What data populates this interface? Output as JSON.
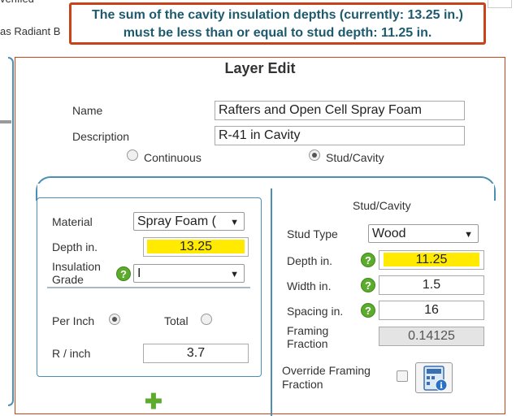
{
  "background": {
    "partial_label_top": "verified",
    "partial_label_radiant": "as Radiant B"
  },
  "error": {
    "line1": "The sum of the cavity insulation depths (currently: 13.25 in.)",
    "line2": "must be less than or equal to stud depth: 11.25 in."
  },
  "layer_edit": {
    "title": "Layer Edit",
    "name_label": "Name",
    "name_value": "Rafters and Open Cell Spray Foam",
    "description_label": "Description",
    "description_value": "R-41 in Cavity",
    "continuous_label": "Continuous",
    "stud_cavity_label": "Stud/Cavity",
    "selected_type": "Stud/Cavity"
  },
  "material_panel": {
    "material_label": "Material",
    "material_value": "Spray Foam (",
    "depth_label": "Depth in.",
    "depth_value": "13.25",
    "insulation_grade_label": "Insulation Grade",
    "insulation_grade_value": "I",
    "per_inch_label": "Per Inch",
    "total_label": "Total",
    "selected_mode": "Per Inch",
    "r_label": "R / inch",
    "r_value": "3.7",
    "add_icon": "plus-icon"
  },
  "stud_panel": {
    "title": "Stud/Cavity",
    "stud_type_label": "Stud Type",
    "stud_type_value": "Wood",
    "depth_label": "Depth in.",
    "depth_value": "11.25",
    "width_label": "Width in.",
    "width_value": "1.5",
    "spacing_label": "Spacing in.",
    "spacing_value": "16",
    "framing_fraction_label": "Framing Fraction",
    "framing_fraction_value": "0.14125",
    "override_label": "Override Framing Fraction",
    "override_checked": false,
    "calc_icon": "calculator-info-icon"
  },
  "colors": {
    "error_border": "#c9431a",
    "error_text": "#1e5a6e",
    "accent_blue": "#4b8fb5",
    "highlight": "#ffea00",
    "help_green": "#5cab2d"
  }
}
